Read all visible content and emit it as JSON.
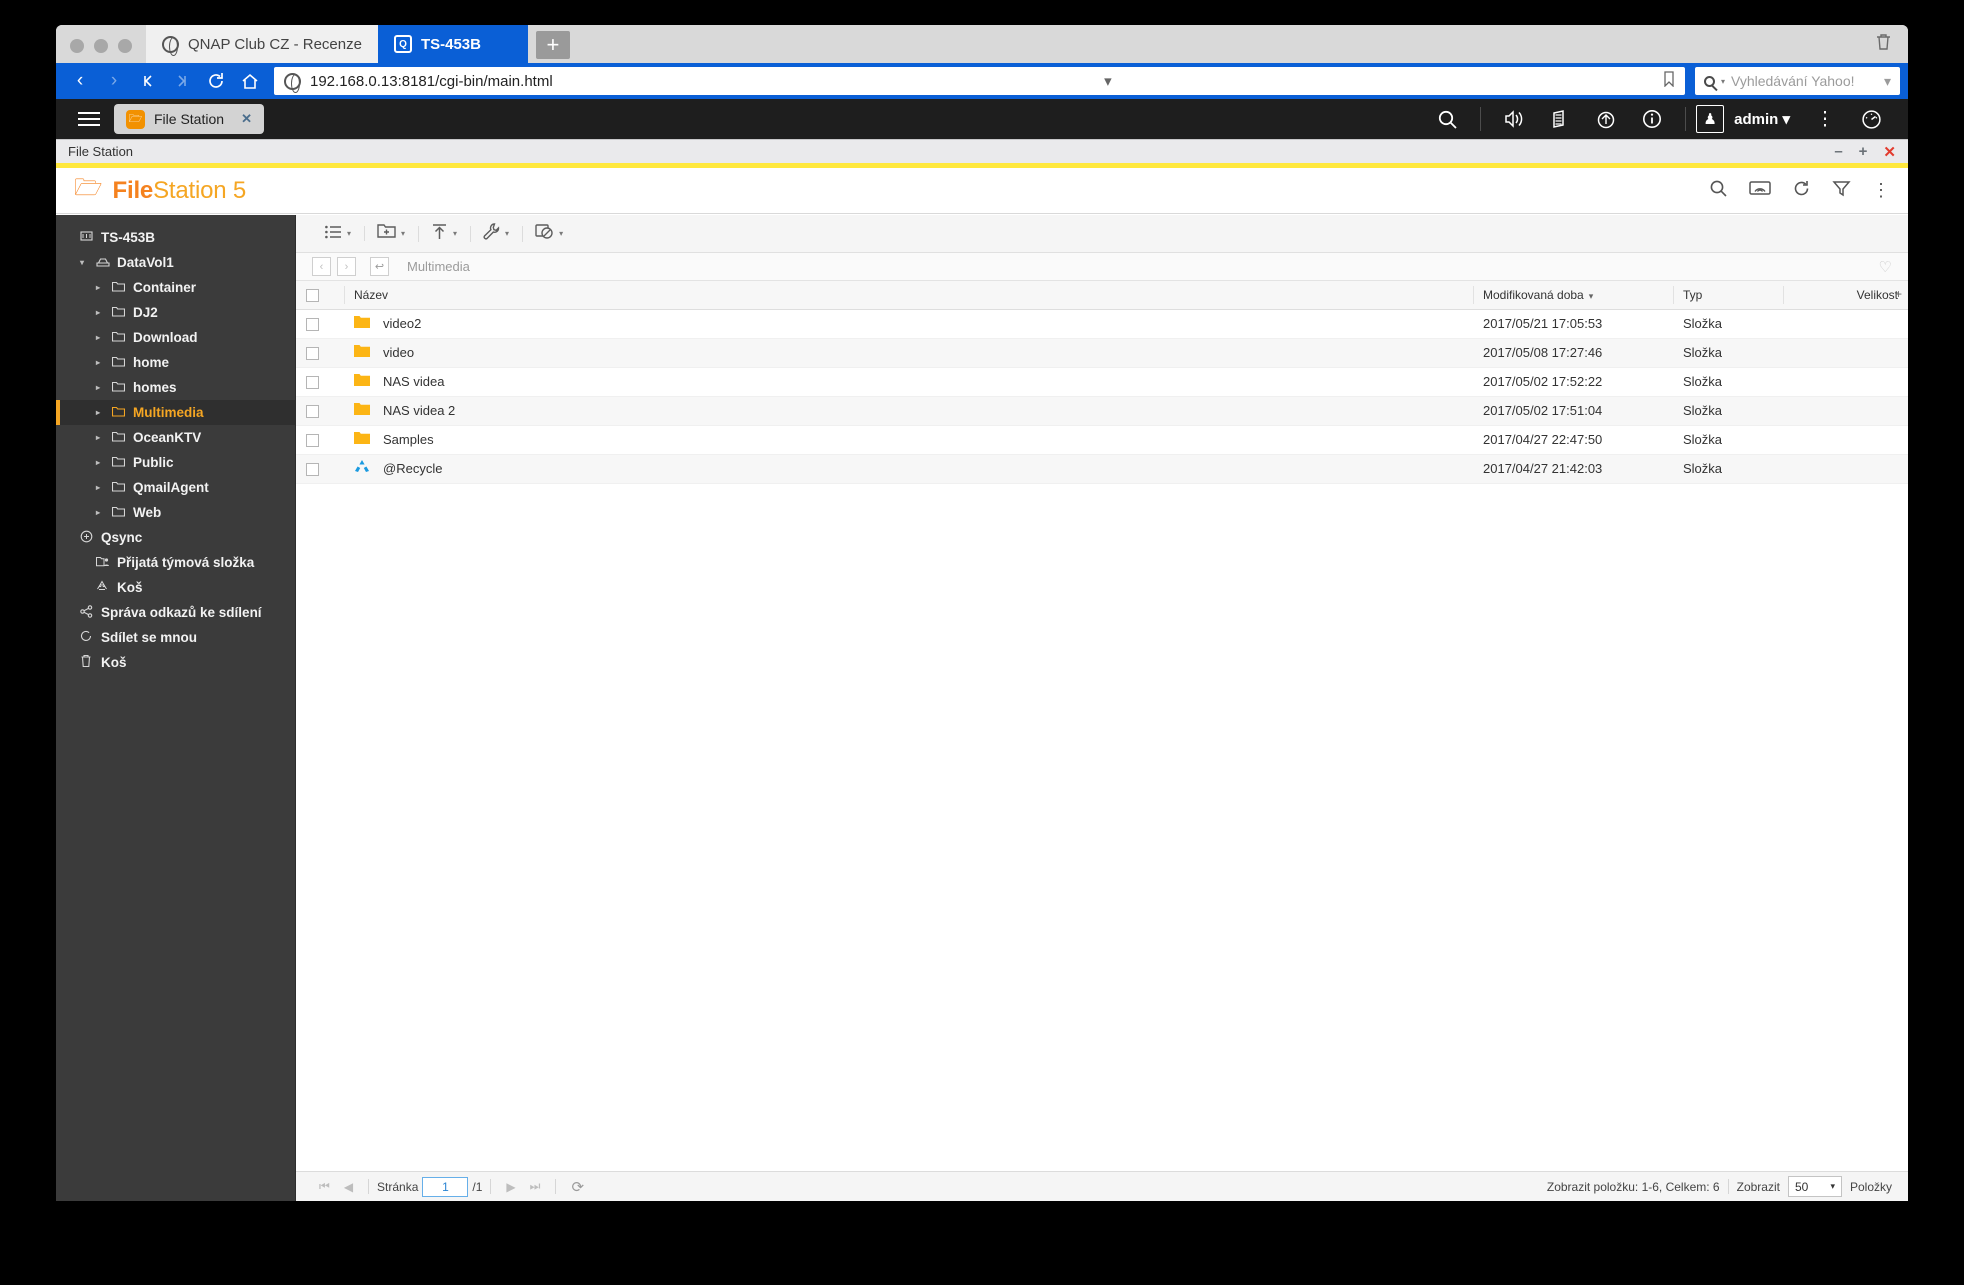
{
  "browser": {
    "tabs": [
      {
        "title": "QNAP Club CZ - Recenze",
        "icon": "globe-icon",
        "active": false
      },
      {
        "title": "TS-453B",
        "icon": "qnap-icon",
        "active": true
      }
    ],
    "new_tab_label": "+",
    "trash_icon": "trash-icon",
    "nav": {
      "back": "‹",
      "forward": "›",
      "first": "⏮",
      "last": "⏭",
      "reload": "⟳",
      "home": "⌂"
    },
    "url": "192.168.0.13:8181/cgi-bin/main.html",
    "url_caret": "▾",
    "bookmark_icon": "bookmark-icon",
    "search_placeholder": "Vyhledávání Yahoo!",
    "search_caret": "▾"
  },
  "qts": {
    "app_tab_label": "File Station",
    "app_tab_close": "✕",
    "icons": [
      {
        "name": "search-icon",
        "glyph": "⌕"
      },
      {
        "name": "volume-icon",
        "glyph": "⏵"
      },
      {
        "name": "backup-icon",
        "glyph": "☰"
      },
      {
        "name": "recycle-icon",
        "glyph": "♻"
      },
      {
        "name": "info-icon",
        "glyph": "ⓘ"
      }
    ],
    "username": "admin",
    "user_caret": "▾",
    "more_icon": "⋮",
    "dashboard_icon": "dashboard-icon"
  },
  "window": {
    "title": "File Station",
    "minimize": "–",
    "maximize": "+",
    "close": "✕",
    "accent_color": "#ffe83d"
  },
  "app": {
    "brand_bold": "File",
    "brand_rest": "Station 5",
    "header_icons": [
      {
        "name": "search-icon",
        "glyph": "⌕"
      },
      {
        "name": "cast-icon",
        "glyph": "▭"
      },
      {
        "name": "refresh-icon",
        "glyph": "⟳"
      },
      {
        "name": "filter-icon",
        "glyph": "▽"
      },
      {
        "name": "more-vertical-icon",
        "glyph": "⋮"
      }
    ]
  },
  "sidebar": {
    "items": [
      {
        "label": "TS-453B",
        "indent": 0,
        "icon": "nas-icon",
        "arrow": "",
        "selected": false,
        "bold": true
      },
      {
        "label": "DataVol1",
        "indent": 1,
        "icon": "volume-icon",
        "arrow": "▾",
        "selected": false,
        "bold": true
      },
      {
        "label": "Container",
        "indent": 2,
        "icon": "folder-icon",
        "arrow": "▸",
        "selected": false,
        "bold": true
      },
      {
        "label": "DJ2",
        "indent": 2,
        "icon": "folder-icon",
        "arrow": "▸",
        "selected": false,
        "bold": true
      },
      {
        "label": "Download",
        "indent": 2,
        "icon": "folder-icon",
        "arrow": "▸",
        "selected": false,
        "bold": true
      },
      {
        "label": "home",
        "indent": 2,
        "icon": "folder-icon",
        "arrow": "▸",
        "selected": false,
        "bold": true
      },
      {
        "label": "homes",
        "indent": 2,
        "icon": "folder-icon",
        "arrow": "▸",
        "selected": false,
        "bold": true
      },
      {
        "label": "Multimedia",
        "indent": 2,
        "icon": "folder-icon",
        "arrow": "▸",
        "selected": true,
        "bold": true
      },
      {
        "label": "OceanKTV",
        "indent": 2,
        "icon": "folder-icon",
        "arrow": "▸",
        "selected": false,
        "bold": true
      },
      {
        "label": "Public",
        "indent": 2,
        "icon": "folder-icon",
        "arrow": "▸",
        "selected": false,
        "bold": true
      },
      {
        "label": "QmailAgent",
        "indent": 2,
        "icon": "folder-icon",
        "arrow": "▸",
        "selected": false,
        "bold": true
      },
      {
        "label": "Web",
        "indent": 2,
        "icon": "folder-icon",
        "arrow": "▸",
        "selected": false,
        "bold": true
      },
      {
        "label": "Qsync",
        "indent": 0,
        "icon": "qsync-icon",
        "arrow": "",
        "selected": false,
        "bold": true
      },
      {
        "label": "Přijatá týmová složka",
        "indent": 1,
        "icon": "team-folder-icon",
        "arrow": "",
        "selected": false,
        "bold": true
      },
      {
        "label": "Koš",
        "indent": 1,
        "icon": "recycle-icon",
        "arrow": "",
        "selected": false,
        "bold": true
      },
      {
        "label": "Správa odkazů ke sdílení",
        "indent": 0,
        "icon": "share-icon",
        "arrow": "",
        "selected": false,
        "bold": true
      },
      {
        "label": "Sdílet se mnou",
        "indent": 0,
        "icon": "shared-icon",
        "arrow": "",
        "selected": false,
        "bold": true
      },
      {
        "label": "Koš",
        "indent": 0,
        "icon": "trash-icon",
        "arrow": "",
        "selected": false,
        "bold": true
      }
    ]
  },
  "toolbar": {
    "groups": [
      {
        "name": "view-mode-button",
        "glyph": "☰",
        "caret": "▾"
      },
      {
        "name": "new-folder-button",
        "glyph": "➕",
        "caret": "▾"
      },
      {
        "name": "upload-button",
        "glyph": "↑",
        "caret": "▾"
      },
      {
        "name": "tools-button",
        "glyph": "🔧",
        "caret": "▾"
      },
      {
        "name": "more-actions-button",
        "glyph": "⊘",
        "caret": "▾"
      }
    ]
  },
  "breadcrumb": {
    "back": "‹",
    "forward": "›",
    "up": "↩",
    "path": "Multimedia",
    "favorite_icon": "heart-icon"
  },
  "table": {
    "columns": [
      {
        "label": "",
        "key": "check"
      },
      {
        "label": "Název",
        "key": "name"
      },
      {
        "label": "Modifikovaná doba",
        "key": "modified",
        "sort": "▾"
      },
      {
        "label": "Typ",
        "key": "type"
      },
      {
        "label": "Velikost",
        "key": "size"
      }
    ],
    "column_add_icon": "+",
    "rows": [
      {
        "name": "video2",
        "modified": "2017/05/21 17:05:53",
        "type": "Složka",
        "size": "",
        "icon": "folder-icon"
      },
      {
        "name": "video",
        "modified": "2017/05/08 17:27:46",
        "type": "Složka",
        "size": "",
        "icon": "folder-icon"
      },
      {
        "name": "NAS videa",
        "modified": "2017/05/02 17:52:22",
        "type": "Složka",
        "size": "",
        "icon": "folder-icon"
      },
      {
        "name": "NAS videa 2",
        "modified": "2017/05/02 17:51:04",
        "type": "Složka",
        "size": "",
        "icon": "folder-icon"
      },
      {
        "name": "Samples",
        "modified": "2017/04/27 22:47:50",
        "type": "Složka",
        "size": "",
        "icon": "folder-icon"
      },
      {
        "name": "@Recycle",
        "modified": "2017/04/27 21:42:03",
        "type": "Složka",
        "size": "",
        "icon": "recycle-icon"
      }
    ]
  },
  "status": {
    "first_page": "⏮",
    "prev_page": "◀",
    "page_label": "Stránka",
    "page_value": "1",
    "page_total": "/1",
    "next_page": "▶",
    "last_page": "⏭",
    "refresh": "⟳",
    "summary": "Zobrazit položku: 1-6, Celkem: 6",
    "show_label": "Zobrazit",
    "page_size": "50",
    "page_size_caret": "▾",
    "items_label": "Položky"
  }
}
